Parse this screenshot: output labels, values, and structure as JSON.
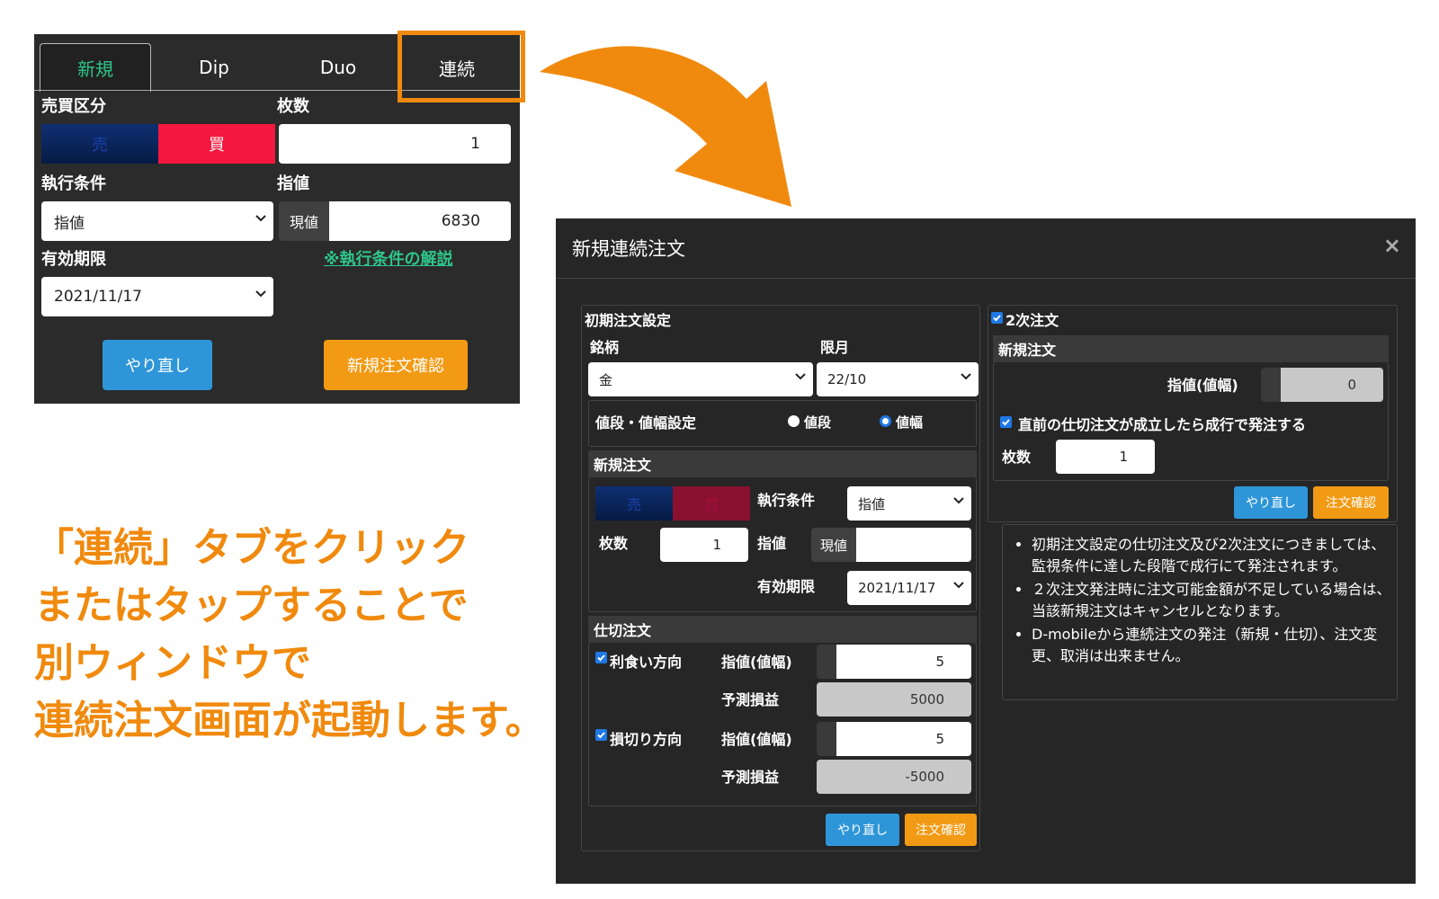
{
  "tabs": [
    "新規",
    "Dip",
    "Duo",
    "連続"
  ],
  "left_panel": {
    "buy_sell_label": "売買区分",
    "sell": "売",
    "buy": "買",
    "qty_label": "枚数",
    "qty_value": "1",
    "exec_label": "執行条件",
    "exec_value": "指値",
    "limit_label": "指値",
    "current_btn": "現値",
    "limit_value": "6830",
    "expiry_label": "有効期限",
    "expiry_value": "2021/11/17",
    "explain_link": "※執行条件の解説",
    "reset_button": "やり直し",
    "confirm_button": "新規注文確認"
  },
  "caption": [
    "「連続」タブをクリック",
    "またはタップすることで",
    "別ウィンドウで",
    "連続注文画面が起動します。"
  ],
  "modal": {
    "title": "新規連続注文",
    "close": "×",
    "initial": {
      "header": "初期注文設定",
      "symbol_label": "銘柄",
      "symbol_value": "金",
      "month_label": "限月",
      "month_value": "22/10",
      "price_setting_label": "値段・値幅設定",
      "radio_price": "値段",
      "radio_width": "値幅"
    },
    "new_order": {
      "header": "新規注文",
      "sell": "売",
      "buy": "買",
      "exec_label": "執行条件",
      "exec_value": "指値",
      "qty_label": "枚数",
      "qty_value": "1",
      "limit_label": "指値",
      "current_btn": "現値",
      "limit_value": "",
      "expiry_label": "有効期限",
      "expiry_value": "2021/11/17"
    },
    "close_order": {
      "header": "仕切注文",
      "profit_label": "利食い方向",
      "profit_limit_label": "指値(値幅)",
      "profit_limit_value": "5",
      "profit_pl_label": "予測損益",
      "profit_pl_value": "5000",
      "loss_label": "損切り方向",
      "loss_limit_label": "指値(値幅)",
      "loss_limit_value": "5",
      "loss_pl_label": "予測損益",
      "loss_pl_value": "-5000"
    },
    "left_reset": "やり直し",
    "left_confirm": "注文確認",
    "second": {
      "checkbox_label": "2次注文",
      "header": "新規注文",
      "limit_label": "指値(値幅)",
      "limit_value": "0",
      "market_check": "直前の仕切注文が成立したら成行で発注する",
      "qty_label": "枚数",
      "qty_value": "1",
      "reset": "やり直し",
      "confirm": "注文確認"
    },
    "notes": [
      "初期注文設定の仕切注文及び2次注文につきましては、監視条件に達した段階で成行にて発注されます。",
      "２次注文発注時に注文可能金額が不足している場合は、当該新規注文はキャンセルとなります。",
      "D-mobileから連続注文の発注（新規・仕切）、注文変更、取消は出来ません。"
    ]
  },
  "colors": {
    "accent_green": "#2ec68a",
    "highlight_orange": "#f08a0e",
    "button_blue": "#2e96d8",
    "button_orange": "#f29a14",
    "sell_navy": "#0a2a6a",
    "buy_red": "#f4173e"
  },
  "icons": [
    "chevron-down-icon",
    "close-icon",
    "checkbox-checked-icon",
    "arrow-icon"
  ]
}
